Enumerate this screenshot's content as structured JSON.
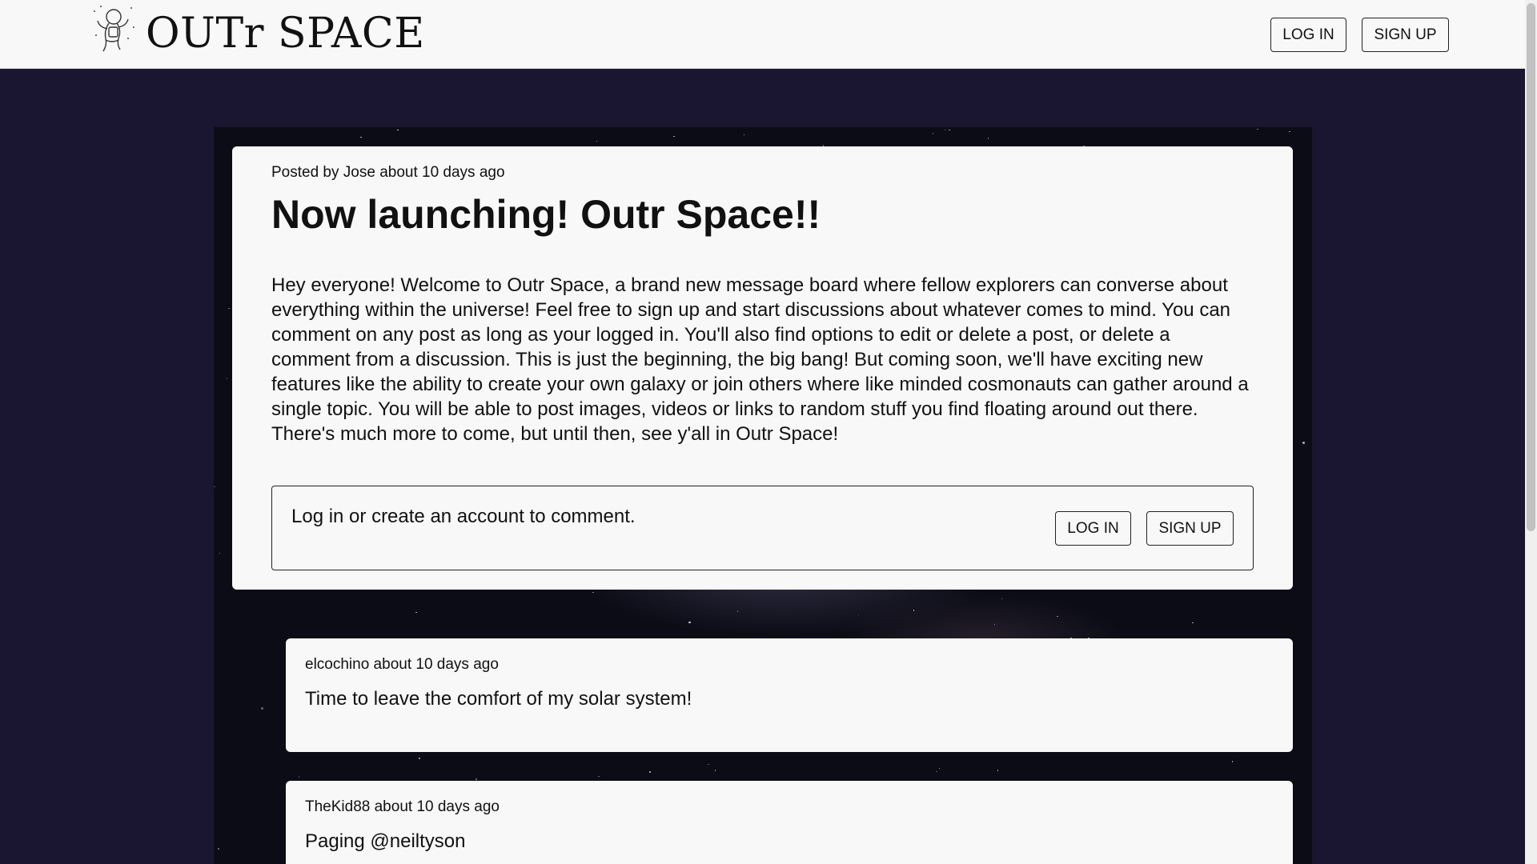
{
  "header": {
    "brand": "OUTr SPACE",
    "logo_icon": "astronaut-icon",
    "login_label": "LOG IN",
    "signup_label": "SIGN UP"
  },
  "post": {
    "meta": "Posted by Jose about 10 days ago",
    "title": "Now launching! Outr Space!!",
    "body": "Hey everyone! Welcome to Outr Space, a brand new message board where fellow explorers can converse about everything within the universe! Feel free to sign up and start discussions about whatever comes to mind. You can comment on any post as long as your logged in. You'll also find options to edit or delete a post, or delete a comment from a discussion. This is just the beginning, the big bang! But coming soon, we'll have exciting new features like the ability to create your own galaxy or join others where like minded cosmonauts can gather around a single topic. You will be able to post images, videos or links to random stuff you find floating around out there. There's much more to come, but until then, see y'all in Outr Space!"
  },
  "comment_prompt": {
    "text": "Log in or create an account to comment.",
    "login_label": "LOG IN",
    "signup_label": "SIGN UP"
  },
  "comments": [
    {
      "meta": "elcochino about 10 days ago",
      "text": "Time to leave the comfort of my solar system!"
    },
    {
      "meta": "TheKid88 about 10 days ago",
      "text": "Paging @neiltyson"
    }
  ],
  "colors": {
    "page_background": "#1a1530",
    "card_background": "#f8f8f8",
    "space_background": "#0b0c16"
  }
}
